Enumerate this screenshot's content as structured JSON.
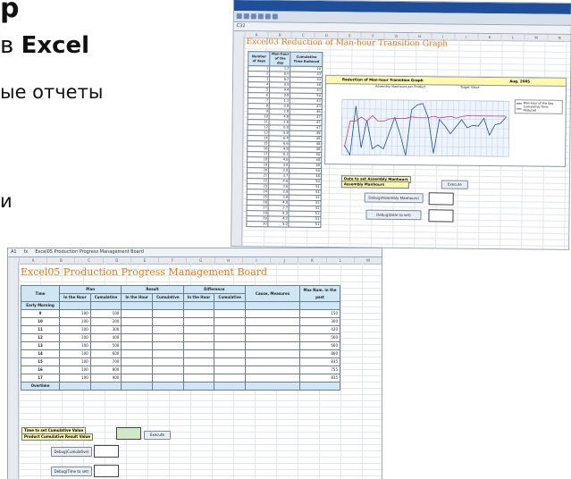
{
  "slide": {
    "title_fragment": "p",
    "line1_prefix": "в",
    "line1_bold": "Excel",
    "line2": "ые отчеты",
    "line3": "и"
  },
  "shot1": {
    "formula_cell": "C32",
    "sheet_title": "Excel03 Reduction of Man-hour Transition Graph",
    "table_headers": [
      "Number of days",
      "Man-hour of the day",
      "Cumulative Time Reduced"
    ],
    "rows": [
      [
        "1",
        "1.2",
        "10"
      ],
      [
        "2",
        "0.0",
        "43"
      ],
      [
        "3",
        "6.2",
        "43"
      ],
      [
        "4",
        "0.9",
        "48"
      ],
      [
        "5",
        "4.4",
        "43"
      ],
      [
        "6",
        "0.8",
        "50"
      ],
      [
        "7",
        "1.3",
        "43"
      ],
      [
        "8",
        "0.8",
        "43"
      ],
      [
        "9",
        "2.8",
        "46"
      ],
      [
        "10",
        "4.8",
        "47"
      ],
      [
        "11",
        "2.6",
        "47"
      ],
      [
        "12",
        "0.0",
        "47"
      ],
      [
        "13",
        "5.8",
        "49"
      ],
      [
        "14",
        "6.4",
        "48"
      ],
      [
        "15",
        "6.6",
        "48"
      ],
      [
        "16",
        "4.8",
        "48"
      ],
      [
        "17",
        "0.3",
        "50"
      ],
      [
        "18",
        "4.6",
        "48"
      ],
      [
        "19",
        "3.8",
        "49"
      ],
      [
        "20",
        "2.8",
        "50"
      ],
      [
        "21",
        "3.7",
        "48"
      ],
      [
        "22",
        "4.6",
        "50"
      ],
      [
        "23",
        "3.6",
        "51"
      ],
      [
        "24",
        "3.9",
        "51"
      ],
      [
        "25",
        "3.8",
        "51"
      ],
      [
        "26",
        "4.8",
        "51"
      ],
      [
        "27",
        "2.7",
        "51"
      ],
      [
        "28",
        "4.0",
        "51"
      ],
      [
        "29",
        "4.2",
        "51"
      ],
      [
        "30",
        "5.0",
        "51"
      ]
    ],
    "chart_banner": "Reduction of Man-hour Transition Graph",
    "chart_banner_right": "Aug. 2005",
    "chart_sub_left": "Assembly Manhours per Product",
    "chart_sub_right": "Target Value",
    "legend": [
      "Man-hour of the day",
      "Cumulative Time Reduced"
    ],
    "form_label1": "Date to set Assembly Manhours",
    "form_label2": "Assembly Manhours",
    "btn_execute": "Execute",
    "btn_debug_assembly": "Debug(Assembly Manhours)",
    "btn_debug_date": "Debug(Date to set)",
    "colors": {
      "line_blue": "#1f4f9a",
      "line_pink": "#c2408a",
      "accent_yellow": "#fff9b0",
      "header_blue": "#cfe6f5",
      "title_orange": "#e07a1f"
    }
  },
  "shot2": {
    "cell_ref": "A1",
    "fx": "fx",
    "formula": "Excel05 Production Progress Management Board",
    "sheet_title": "Excel05 Production Progress Management Board",
    "col_time": "Time",
    "col_plan": "Plan",
    "col_result": "Result",
    "col_diff": "Difference",
    "col_cause": "Cause, Measures",
    "col_maxnum": "Max Num. in the past",
    "sub_in_hour": "In the Hour",
    "sub_cumulative": "Cumulative",
    "early_morning": "Early Morning",
    "overtime": "Overtime",
    "rows": [
      {
        "time": "9",
        "plan_h": "100",
        "plan_c": "100",
        "max": "150"
      },
      {
        "time": "10",
        "plan_h": "100",
        "plan_c": "200",
        "max": "300"
      },
      {
        "time": "11",
        "plan_h": "100",
        "plan_c": "300",
        "max": "420"
      },
      {
        "time": "12",
        "plan_h": "100",
        "plan_c": "400",
        "max": "560"
      },
      {
        "time": "13",
        "plan_h": "100",
        "plan_c": "500",
        "max": "660"
      },
      {
        "time": "14",
        "plan_h": "100",
        "plan_c": "600",
        "max": "860"
      },
      {
        "time": "15",
        "plan_h": "100",
        "plan_c": "700",
        "max": "835"
      },
      {
        "time": "16",
        "plan_h": "100",
        "plan_c": "800",
        "max": "755"
      },
      {
        "time": "17",
        "plan_h": "100",
        "plan_c": "900",
        "max": "835"
      }
    ],
    "form_label1": "Time to set Cumulative Value",
    "form_label2": "Product Cumulative Result Value",
    "btn_execute": "Execute",
    "btn_debug_cumulative": "Debug(Cumulative)",
    "btn_debug_time": "Debug(Time to set)"
  }
}
